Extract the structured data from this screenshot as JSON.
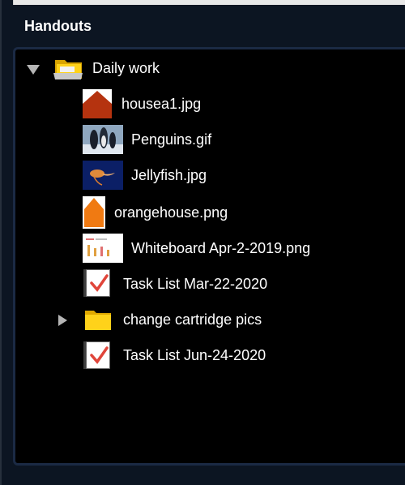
{
  "panel": {
    "title": "Handouts"
  },
  "tree": {
    "root": {
      "label": "Daily work",
      "expanded": true,
      "icon": "open-folder-icon"
    },
    "items": [
      {
        "label": "housea1.jpg",
        "icon": "house-image-thumbnail"
      },
      {
        "label": "Penguins.gif",
        "icon": "penguins-image-thumbnail"
      },
      {
        "label": "Jellyfish.jpg",
        "icon": "jellyfish-image-thumbnail"
      },
      {
        "label": "orangehouse.png",
        "icon": "orange-house-thumbnail"
      },
      {
        "label": "Whiteboard Apr-2-2019.png",
        "icon": "whiteboard-thumbnail"
      },
      {
        "label": "Task List Mar-22-2020",
        "icon": "checklist-icon"
      },
      {
        "label": "change cartridge pics",
        "icon": "folder-icon",
        "expanded": false
      },
      {
        "label": "Task List Jun-24-2020",
        "icon": "checklist-icon"
      }
    ]
  }
}
